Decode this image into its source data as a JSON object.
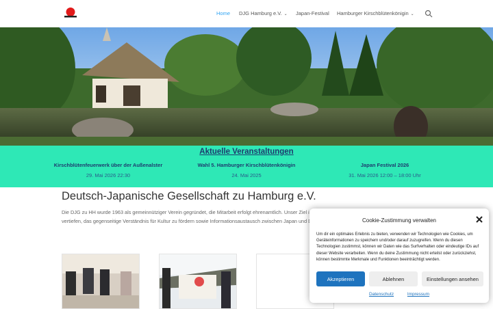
{
  "nav": {
    "items": [
      {
        "label": "Home",
        "active": true,
        "dropdown": false
      },
      {
        "label": "DJG Hamburg e.V.",
        "active": false,
        "dropdown": true
      },
      {
        "label": "Japan-Festival",
        "active": false,
        "dropdown": false
      },
      {
        "label": "Hamburger Kirschblütenkönigin",
        "active": false,
        "dropdown": true
      }
    ]
  },
  "events": {
    "title": "Aktuelle Veranstaltungen",
    "items": [
      {
        "name": "Kirschblütenfeuerwerk über der Außenalster",
        "date": "29. Mai 2026 22:30"
      },
      {
        "name": "Wahl 5. Hamburger Kirschblütenkönigin",
        "date": "24. Mai 2025"
      },
      {
        "name": "Japan Festival 2026",
        "date": "31. Mai 2026 12:00 – 18:00 Uhr"
      }
    ]
  },
  "main": {
    "title": "Deutsch-Japanische Gesellschaft zu Hamburg e.V.",
    "paragraph": "Die DJG zu HH wurde 1963 als gemeinnütziger Verein gegründet, die Mitarbeit erfolgt ehrenamtlich. Unser Ziel ist es, die Beziehungen zwischen Hamburg und Japan zu vertiefen, das gegenseitige Verständnis für Kultur zu fördern sowie Informationsaustausch zwischen Japan und Deutschland zu unterstützen."
  },
  "cookie": {
    "title": "Cookie-Zustimmung verwalten",
    "text": "Um dir ein optimales Erlebnis zu bieten, verwenden wir Technologien wie Cookies, um Geräteinformationen zu speichern und/oder darauf zuzugreifen. Wenn du diesen Technologien zustimmst, können wir Daten wie das Surfverhalten oder eindeutige IDs auf dieser Website verarbeiten. Wenn du deine Zustimmung nicht erteilst oder zurückziehst, können bestimmte Merkmale und Funktionen beeinträchtigt werden.",
    "accept": "Akzeptieren",
    "deny": "Ablehnen",
    "settings": "Einstellungen ansehen",
    "link_privacy": "Datenschutz",
    "link_imprint": "Impressum"
  },
  "colors": {
    "accent": "#2ea3f2",
    "events_bg": "#2ee8b6",
    "button_primary": "#1e73be"
  }
}
